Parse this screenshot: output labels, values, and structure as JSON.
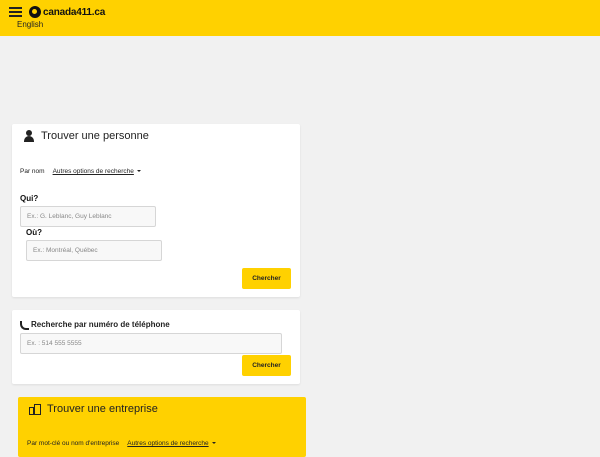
{
  "header": {
    "logo_text": "canada411.ca",
    "language": "English",
    "brand_color": "#ffd100"
  },
  "person_card": {
    "title": "Trouver une personne",
    "by_label": "Par nom",
    "options_link": "Autres options de recherche",
    "who_label": "Qui?",
    "who_placeholder": "Ex.: G. Leblanc, Guy Leblanc",
    "where_label": "Où?",
    "where_placeholder": "Ex.: Montréal, Québec",
    "search_button": "Chercher"
  },
  "phone_card": {
    "title": "Recherche par numéro de téléphone",
    "placeholder": "Ex. : 514 555 5555",
    "search_button": "Chercher"
  },
  "business_card": {
    "title": "Trouver une entreprise",
    "by_label": "Par mot-clé ou nom d'entreprise",
    "options_link": "Autres options de recherche"
  },
  "icons": [
    "menu-icon",
    "canada411-logo-icon",
    "person-icon",
    "phone-icon",
    "building-icon",
    "caret-down-icon"
  ]
}
